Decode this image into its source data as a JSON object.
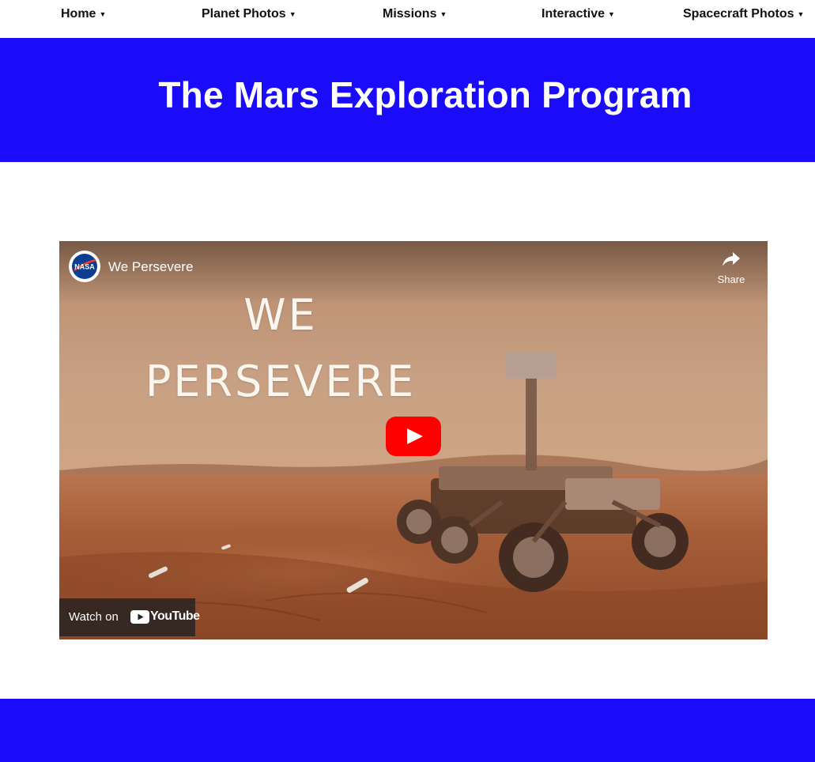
{
  "nav": {
    "items": [
      {
        "label": "Home",
        "caret": "▼"
      },
      {
        "label": "Planet Photos",
        "caret": "▼"
      },
      {
        "label": "Missions",
        "caret": "▼"
      },
      {
        "label": "Interactive",
        "caret": "▼"
      },
      {
        "label": "Spacecraft Photos",
        "caret": "▼"
      }
    ]
  },
  "header": {
    "title": "The Mars Exploration Program"
  },
  "video": {
    "channel_logo_text": "NASA",
    "title": "We Persevere",
    "share_label": "Share",
    "overlay_line1": "WE",
    "overlay_line2": "PERSEVERE",
    "watch_on_label": "Watch on",
    "youtube_word": "YouTube",
    "icons": [
      "nasa-logo",
      "share-icon",
      "play-icon",
      "youtube-icon"
    ]
  },
  "colors": {
    "brand_blue": "#1a0cfa",
    "youtube_red": "#ff0000",
    "mars_sky": "#c79a7a",
    "mars_ground": "#a0532c"
  }
}
